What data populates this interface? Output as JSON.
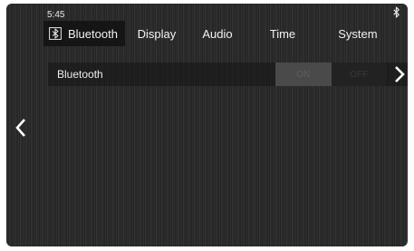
{
  "status_bar": {
    "time": "5:45",
    "bluetooth_icon": "bluetooth-icon"
  },
  "tabs": [
    {
      "label": "Bluetooth",
      "icon": "bluetooth-icon",
      "active": true
    },
    {
      "label": "Display",
      "active": false
    },
    {
      "label": "Audio",
      "active": false
    },
    {
      "label": "Time",
      "active": false
    },
    {
      "label": "System",
      "active": false
    }
  ],
  "settings": {
    "bluetooth": {
      "label": "Bluetooth",
      "on_label": "ON",
      "off_label": "OFF",
      "chevron_icon": "chevron-right-icon"
    }
  },
  "nav": {
    "back_icon": "chevron-left-icon"
  },
  "colors": {
    "background": "#2c2c2c",
    "active_tab": "#151515",
    "text": "#f2f2f2",
    "toggle_on": "#4a4a4a",
    "toggle_off": "#222222"
  }
}
